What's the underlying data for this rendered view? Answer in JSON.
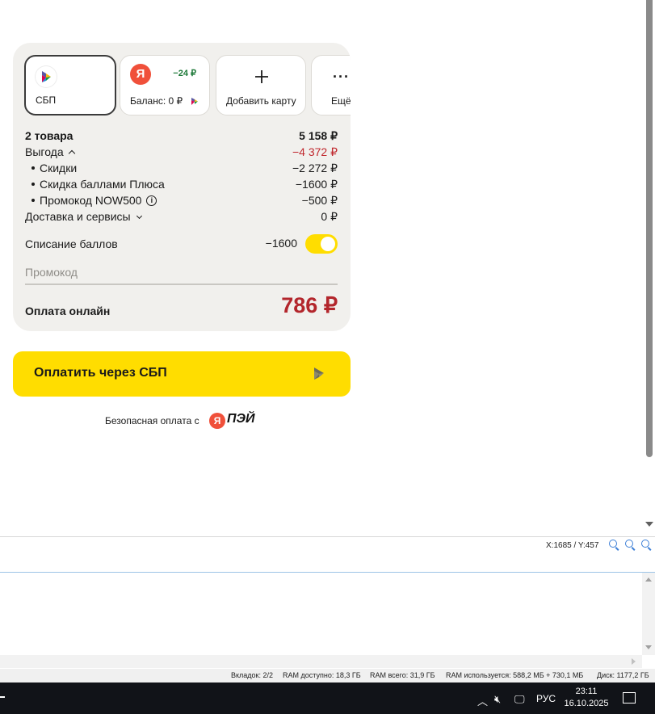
{
  "payment_methods": [
    {
      "label": "СБП",
      "icon": "sbp-logo-icon",
      "selected": true
    },
    {
      "label": "Баланс: 0 ₽",
      "icon": "yandex-logo-icon",
      "badge": "−24 ₽"
    },
    {
      "label": "Добавить карту",
      "icon": "plus-icon"
    },
    {
      "label": "Ещё",
      "icon": "more-dots-icon"
    }
  ],
  "summary": {
    "items": {
      "label": "2 товара",
      "value": "5 158 ₽"
    },
    "benefit": {
      "label": "Выгода",
      "value": "−4 372 ₽"
    },
    "discounts": {
      "label": "Скидки",
      "value": "−2 272 ₽"
    },
    "plus_points": {
      "label": "Скидка баллами Плюса",
      "value": "−1600 ₽"
    },
    "promo_code": {
      "label": "Промокод NOW500",
      "value": "−500 ₽"
    },
    "delivery": {
      "label": "Доставка и сервисы",
      "value": "0 ₽"
    }
  },
  "points": {
    "label": "Списание баллов",
    "value": "−1600",
    "enabled": true
  },
  "promo": {
    "placeholder": "Промокод"
  },
  "total": {
    "label": "Оплата онлайн",
    "value": "786 ₽"
  },
  "pay_button": {
    "label": "Оплатить через СБП"
  },
  "secure": {
    "text": "Безопасная оплата с",
    "logo_letter": "Я",
    "logo_text": "ПЭЙ"
  },
  "viewer": {
    "coords": "X:1685 / Y:457"
  },
  "statusbar": {
    "tabs": "Вкладок: 2/2",
    "ram_free": "RAM доступно: 18,3 ГБ",
    "ram_total": "RAM всего: 31,9 ГБ",
    "ram_used": "RAM используется: 588,2 МБ + 730,1 МБ",
    "disk": "Диск: 1177,2 ГБ"
  },
  "taskbar": {
    "language": "РУС",
    "time": "23:11",
    "date": "16.10.2025"
  },
  "colors": {
    "accent_yellow": "#ffdd00",
    "price_red": "#b3262c",
    "bonus_green": "#1f7a3a",
    "card_bg": "#f1f0ed"
  }
}
